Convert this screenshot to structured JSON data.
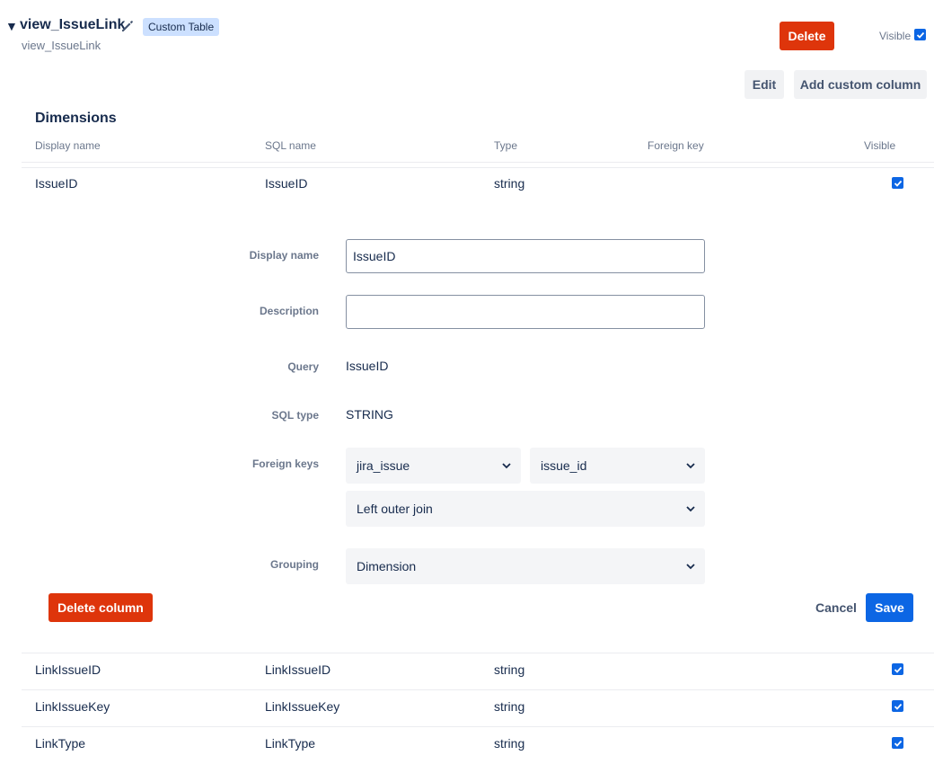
{
  "table": {
    "title": "view_IssueLink",
    "subtitle": "view_IssueLink",
    "badge": "Custom Table",
    "delete_label": "Delete",
    "visible_label": "Visible",
    "edit_label": "Edit",
    "add_column_label": "Add custom column"
  },
  "section": {
    "title": "Dimensions"
  },
  "columns": {
    "display_name": "Display name",
    "sql_name": "SQL name",
    "type": "Type",
    "foreign_key": "Foreign key",
    "visible": "Visible"
  },
  "rows": [
    {
      "display": "IssueID",
      "sql": "IssueID",
      "type": "string",
      "visible": true
    },
    {
      "display": "LinkIssueID",
      "sql": "LinkIssueID",
      "type": "string",
      "visible": true
    },
    {
      "display": "LinkIssueKey",
      "sql": "LinkIssueKey",
      "type": "string",
      "visible": true
    },
    {
      "display": "LinkType",
      "sql": "LinkType",
      "type": "string",
      "visible": true
    }
  ],
  "form": {
    "display_name_label": "Display name",
    "display_name_value": "IssueID",
    "description_label": "Description",
    "description_value": "",
    "query_label": "Query",
    "query_value": "IssueID",
    "sql_type_label": "SQL type",
    "sql_type_value": "STRING",
    "foreign_keys_label": "Foreign keys",
    "fk_table": "jira_issue",
    "fk_column": "issue_id",
    "fk_join": "Left outer join",
    "grouping_label": "Grouping",
    "grouping_value": "Dimension",
    "delete_column_label": "Delete column",
    "cancel_label": "Cancel",
    "save_label": "Save"
  },
  "icons": {
    "caret": "caret-down-icon",
    "pencil": "pencil-icon",
    "check": "checkmark-icon",
    "chevron": "chevron-down-icon"
  },
  "colors": {
    "danger": "#de350b",
    "primary": "#0c66e4",
    "badge": "#cce0ff"
  }
}
